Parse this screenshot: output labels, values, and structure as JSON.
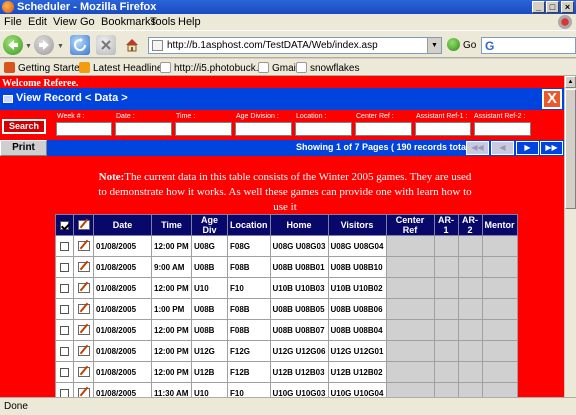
{
  "window": {
    "title": "Scheduler - Mozilla Firefox"
  },
  "menu": [
    "File",
    "Edit",
    "View",
    "Go",
    "Bookmarks",
    "Tools",
    "Help"
  ],
  "nav": {
    "url": "http://b.1asphost.com/TestDATA/Web/index.asp",
    "go_label": "Go"
  },
  "bookmarks": [
    "Getting Started",
    "Latest Headlines",
    "http://i5.photobuck...",
    "Gmail",
    "snowflakes"
  ],
  "page": {
    "welcome": "Welcome Referee.",
    "view_title": "View Record < Data >",
    "close_label": "X",
    "search_label": "Search",
    "filters": [
      "Week # :",
      "Date :",
      "Time :",
      "Age Division :",
      "Location :",
      "Center Ref :",
      "Assistant Ref-1 :",
      "Assistant Ref-2 :"
    ],
    "print_label": "Print",
    "showing": "Showing 1 of 7 Pages ( 190 records total )",
    "pager": [
      "◀◀",
      "◀",
      "▶",
      "▶▶"
    ],
    "note_bold": "Note:",
    "note_text": "The current data in this table consists of the Winter 2005 games. They are used to demonstrate how it works. As well these games can provide one with learn how to use it"
  },
  "table": {
    "headers": [
      "Date",
      "Time",
      "Age Div",
      "Location",
      "Home",
      "Visitors",
      "Center Ref",
      "AR-1",
      "AR-2",
      "Mentor"
    ],
    "rows": [
      [
        "01/08/2005",
        "12:00 PM",
        "U08G",
        "F08G",
        "U08G U08G03",
        "U08G U08G04"
      ],
      [
        "01/08/2005",
        "9:00 AM",
        "U08B",
        "F08B",
        "U08B U08B01",
        "U08B U08B10"
      ],
      [
        "01/08/2005",
        "12:00 PM",
        "U10",
        "F10",
        "U10B U10B03",
        "U10B U10B02"
      ],
      [
        "01/08/2005",
        "1:00 PM",
        "U08B",
        "F08B",
        "U08B U08B05",
        "U08B U08B06"
      ],
      [
        "01/08/2005",
        "12:00 PM",
        "U08B",
        "F08B",
        "U08B U08B07",
        "U08B U08B04"
      ],
      [
        "01/08/2005",
        "12:00 PM",
        "U12G",
        "F12G",
        "U12G U12G06",
        "U12G U12G01"
      ],
      [
        "01/08/2005",
        "12:00 PM",
        "U12B",
        "F12B",
        "U12B U12B03",
        "U12B U12B02"
      ],
      [
        "01/08/2005",
        "11:30 AM",
        "U10",
        "F10",
        "U10G U10G03",
        "U10G U10G04"
      ]
    ]
  },
  "status": "Done",
  "colors": {
    "page_bg": "#ff0000",
    "bar_blue": "#0044dd",
    "header_navy": "#08086a"
  }
}
